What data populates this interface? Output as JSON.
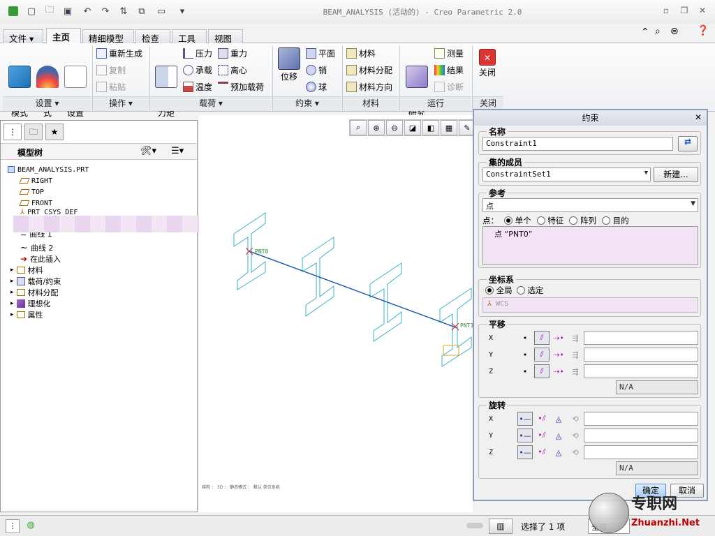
{
  "title": "BEAM_ANALYSIS (活动的) - Creo Parametric 2.0",
  "tabs": [
    "文件 ▾",
    "主页",
    "精细模型",
    "检查",
    "工具",
    "视图"
  ],
  "ribbon": {
    "big_model": "结构\n模式",
    "big_thermal": "热模\n式",
    "big_settings": "模型\n设置",
    "regen": "重新生成",
    "copy": "复制",
    "paste": "粘贴",
    "force": "力/\n力矩",
    "pressure": "压力",
    "bearing": "承载",
    "temperature": "温度",
    "gravity": "重力",
    "centrifugal": "离心",
    "preload": "预加载荷",
    "displacement": "位移",
    "plane": "平面",
    "pin": "销",
    "ball": "球",
    "material": "材料",
    "material_assign": "材料分配",
    "material_dir": "材料方向",
    "analysis": "分析和\n研究",
    "measure": "测量",
    "results": "结果",
    "diagnose": "诊断",
    "close": "关闭",
    "groups": [
      "设置 ▾",
      "操作 ▾",
      "载荷 ▾",
      "约束 ▾",
      "材料",
      "运行",
      "关闭"
    ]
  },
  "tree": {
    "header": "模型树",
    "root": "BEAM_ANALYSIS.PRT",
    "items": [
      "RIGHT",
      "TOP",
      "FRONT",
      "PRT_CSYS_DEF",
      "曲线 1",
      "曲线 2",
      "在此插入",
      "材料",
      "载荷/约束",
      "材料分配",
      "理想化",
      "属性"
    ]
  },
  "canvas": {
    "labels": [
      "PNT0",
      "PNT1"
    ],
    "info": "结构 ： 3D ： 静态模式 ： 默认 单位系统"
  },
  "dialog": {
    "title": "约束",
    "name_label": "名称",
    "name_value": "Constraint1",
    "member_label": "集的成员",
    "member_value": "ConstraintSet1",
    "new_button": "新建...",
    "ref_label": "参考",
    "ref_type": "点",
    "ref_prefix": "点：",
    "ref_options": [
      "单个",
      "特征",
      "阵列",
      "目的"
    ],
    "ref_collected": "点 “PNT0”",
    "csys_label": "坐标系",
    "csys_global": "全局",
    "csys_selected": "选定",
    "csys_value": "WCS",
    "trans_label": "平移",
    "rot_label": "旋转",
    "axes": [
      "X",
      "Y",
      "Z"
    ],
    "na": "N/A",
    "ok": "确定",
    "cancel": "取消"
  },
  "status": {
    "selected": "选择了 1 项",
    "filter": "全部"
  },
  "watermark": {
    "cn": "专职网",
    "en": "Zhuanzhi.Net"
  }
}
